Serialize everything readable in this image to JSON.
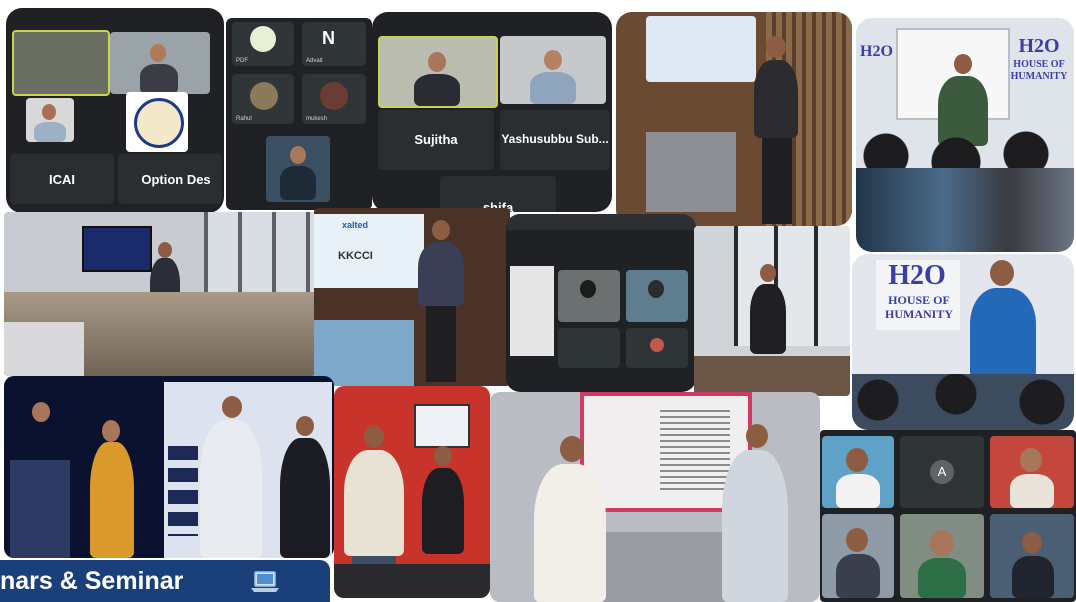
{
  "collage": {
    "banner": {
      "text": "nars & Seminar",
      "icon": "laptop-icon"
    },
    "meet_call_1": {
      "tile_left": "ICAI",
      "tile_right": "Option Des"
    },
    "meet_call_2": {
      "participants": [
        "PDF",
        "Advait",
        "Rahul",
        "mukesh"
      ]
    },
    "meet_call_3": {
      "tiles": [
        "Sujitha",
        "Yashusubbu Sub...",
        "shifa"
      ]
    },
    "slide_screen": {
      "brand": "xalted",
      "org": "KKCCI"
    },
    "house_of_humanity_1": {
      "logo": "H2O",
      "line1": "HOUSE OF",
      "line2": "HUMANITY"
    },
    "house_of_humanity_2": {
      "logo": "H2O",
      "line1": "HOUSE OF",
      "line2": "HUMANITY"
    },
    "meet_call_4": {
      "avatar_letter": "A"
    }
  },
  "colors": {
    "banner_bg": "#1b3f78",
    "banner_text": "#ffffff",
    "meet_bg": "#202124",
    "h2o_blue": "#3a3fa8"
  }
}
